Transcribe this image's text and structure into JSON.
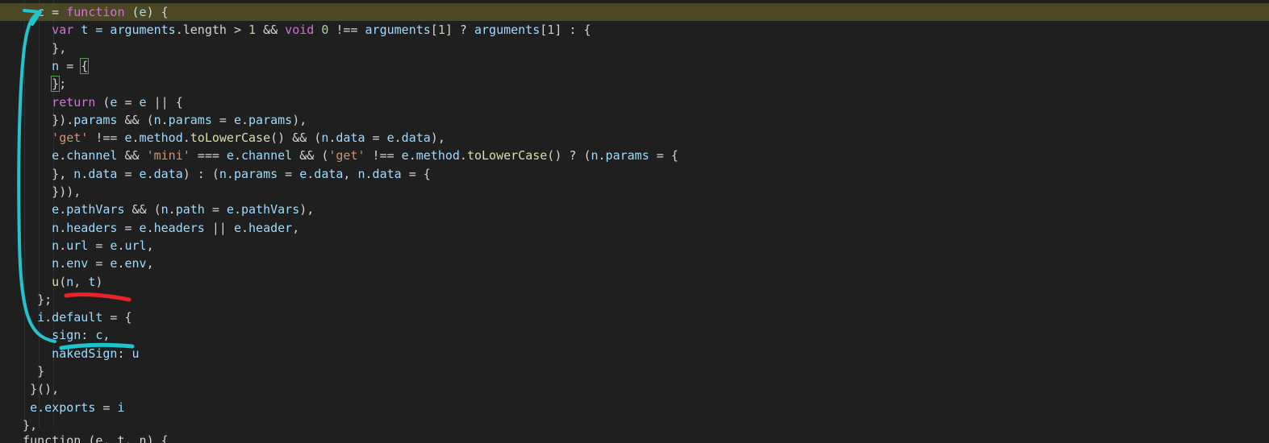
{
  "editor": {
    "lines": [
      {
        "id": "l1",
        "indent": "    ",
        "tokens": [
          {
            "t": "c",
            "k": "var"
          },
          {
            "t": " = ",
            "k": "op"
          },
          {
            "t": "function",
            "k": "kw"
          },
          {
            "t": " (",
            "k": "op"
          },
          {
            "t": "e",
            "k": "var"
          },
          {
            "t": ") {",
            "k": "op"
          }
        ],
        "highlight": true
      },
      {
        "id": "l2",
        "indent": "      ",
        "tokens": [
          {
            "t": "var",
            "k": "kw"
          },
          {
            "t": " t = ",
            "k": "var"
          },
          {
            "t": "arguments",
            "k": "var"
          },
          {
            "t": ".length > ",
            "k": "op"
          },
          {
            "t": "1",
            "k": "num"
          },
          {
            "t": " && ",
            "k": "op"
          },
          {
            "t": "void",
            "k": "kw"
          },
          {
            "t": " 0",
            "k": "num"
          },
          {
            "t": " !== ",
            "k": "op"
          },
          {
            "t": "arguments",
            "k": "var"
          },
          {
            "t": "[",
            "k": "op"
          },
          {
            "t": "1",
            "k": "num"
          },
          {
            "t": "] ? ",
            "k": "op"
          },
          {
            "t": "arguments",
            "k": "var"
          },
          {
            "t": "[",
            "k": "op"
          },
          {
            "t": "1",
            "k": "num"
          },
          {
            "t": "] : {",
            "k": "op"
          }
        ]
      },
      {
        "id": "l3",
        "indent": "      ",
        "tokens": [
          {
            "t": "},",
            "k": "op"
          }
        ]
      },
      {
        "id": "l4",
        "indent": "      ",
        "tokens": [
          {
            "t": "n",
            "k": "var"
          },
          {
            "t": " = ",
            "k": "op"
          },
          {
            "t": "{",
            "k": "box"
          }
        ]
      },
      {
        "id": "l5",
        "indent": "      ",
        "tokens": [
          {
            "t": "}",
            "k": "box"
          },
          {
            "t": ";",
            "k": "op"
          }
        ]
      },
      {
        "id": "l6",
        "indent": "      ",
        "tokens": [
          {
            "t": "return",
            "k": "kw"
          },
          {
            "t": " (",
            "k": "op"
          },
          {
            "t": "e",
            "k": "var"
          },
          {
            "t": " = ",
            "k": "op"
          },
          {
            "t": "e",
            "k": "var"
          },
          {
            "t": " || {",
            "k": "op"
          }
        ]
      },
      {
        "id": "l7",
        "indent": "      ",
        "tokens": [
          {
            "t": "}).",
            "k": "op"
          },
          {
            "t": "params",
            "k": "var"
          },
          {
            "t": " && (",
            "k": "op"
          },
          {
            "t": "n",
            "k": "var"
          },
          {
            "t": ".",
            "k": "op"
          },
          {
            "t": "params",
            "k": "var"
          },
          {
            "t": " = ",
            "k": "op"
          },
          {
            "t": "e",
            "k": "var"
          },
          {
            "t": ".",
            "k": "op"
          },
          {
            "t": "params",
            "k": "var"
          },
          {
            "t": "),",
            "k": "op"
          }
        ]
      },
      {
        "id": "l8",
        "indent": "      ",
        "tokens": [
          {
            "t": "'get'",
            "k": "str"
          },
          {
            "t": " !== ",
            "k": "op"
          },
          {
            "t": "e",
            "k": "var"
          },
          {
            "t": ".",
            "k": "op"
          },
          {
            "t": "method",
            "k": "var"
          },
          {
            "t": ".",
            "k": "op"
          },
          {
            "t": "toLowerCase",
            "k": "fn"
          },
          {
            "t": "() && (",
            "k": "op"
          },
          {
            "t": "n",
            "k": "var"
          },
          {
            "t": ".",
            "k": "op"
          },
          {
            "t": "data",
            "k": "var"
          },
          {
            "t": " = ",
            "k": "op"
          },
          {
            "t": "e",
            "k": "var"
          },
          {
            "t": ".",
            "k": "op"
          },
          {
            "t": "data",
            "k": "var"
          },
          {
            "t": "),",
            "k": "op"
          }
        ]
      },
      {
        "id": "l9",
        "indent": "      ",
        "tokens": [
          {
            "t": "e",
            "k": "var"
          },
          {
            "t": ".",
            "k": "op"
          },
          {
            "t": "channel",
            "k": "var"
          },
          {
            "t": " && ",
            "k": "op"
          },
          {
            "t": "'mini'",
            "k": "str"
          },
          {
            "t": " === ",
            "k": "op"
          },
          {
            "t": "e",
            "k": "var"
          },
          {
            "t": ".",
            "k": "op"
          },
          {
            "t": "channel",
            "k": "var"
          },
          {
            "t": " && (",
            "k": "op"
          },
          {
            "t": "'get'",
            "k": "str"
          },
          {
            "t": " !== ",
            "k": "op"
          },
          {
            "t": "e",
            "k": "var"
          },
          {
            "t": ".",
            "k": "op"
          },
          {
            "t": "method",
            "k": "var"
          },
          {
            "t": ".",
            "k": "op"
          },
          {
            "t": "toLowerCase",
            "k": "fn"
          },
          {
            "t": "() ? (",
            "k": "op"
          },
          {
            "t": "n",
            "k": "var"
          },
          {
            "t": ".",
            "k": "op"
          },
          {
            "t": "params",
            "k": "var"
          },
          {
            "t": " = {",
            "k": "op"
          }
        ]
      },
      {
        "id": "l10",
        "indent": "      ",
        "tokens": [
          {
            "t": "}, ",
            "k": "op"
          },
          {
            "t": "n",
            "k": "var"
          },
          {
            "t": ".",
            "k": "op"
          },
          {
            "t": "data",
            "k": "var"
          },
          {
            "t": " = ",
            "k": "op"
          },
          {
            "t": "e",
            "k": "var"
          },
          {
            "t": ".",
            "k": "op"
          },
          {
            "t": "data",
            "k": "var"
          },
          {
            "t": ") : (",
            "k": "op"
          },
          {
            "t": "n",
            "k": "var"
          },
          {
            "t": ".",
            "k": "op"
          },
          {
            "t": "params",
            "k": "var"
          },
          {
            "t": " = ",
            "k": "op"
          },
          {
            "t": "e",
            "k": "var"
          },
          {
            "t": ".",
            "k": "op"
          },
          {
            "t": "data",
            "k": "var"
          },
          {
            "t": ", ",
            "k": "op"
          },
          {
            "t": "n",
            "k": "var"
          },
          {
            "t": ".",
            "k": "op"
          },
          {
            "t": "data",
            "k": "var"
          },
          {
            "t": " = {",
            "k": "op"
          }
        ]
      },
      {
        "id": "l11",
        "indent": "      ",
        "tokens": [
          {
            "t": "})),",
            "k": "op"
          }
        ]
      },
      {
        "id": "l12",
        "indent": "      ",
        "tokens": [
          {
            "t": "e",
            "k": "var"
          },
          {
            "t": ".",
            "k": "op"
          },
          {
            "t": "pathVars",
            "k": "var"
          },
          {
            "t": " && (",
            "k": "op"
          },
          {
            "t": "n",
            "k": "var"
          },
          {
            "t": ".",
            "k": "op"
          },
          {
            "t": "path",
            "k": "var"
          },
          {
            "t": " = ",
            "k": "op"
          },
          {
            "t": "e",
            "k": "var"
          },
          {
            "t": ".",
            "k": "op"
          },
          {
            "t": "pathVars",
            "k": "var"
          },
          {
            "t": "),",
            "k": "op"
          }
        ]
      },
      {
        "id": "l13",
        "indent": "      ",
        "tokens": [
          {
            "t": "n",
            "k": "var"
          },
          {
            "t": ".",
            "k": "op"
          },
          {
            "t": "headers",
            "k": "var"
          },
          {
            "t": " = ",
            "k": "op"
          },
          {
            "t": "e",
            "k": "var"
          },
          {
            "t": ".",
            "k": "op"
          },
          {
            "t": "headers",
            "k": "var"
          },
          {
            "t": " || ",
            "k": "op"
          },
          {
            "t": "e",
            "k": "var"
          },
          {
            "t": ".",
            "k": "op"
          },
          {
            "t": "header",
            "k": "var"
          },
          {
            "t": ",",
            "k": "op"
          }
        ]
      },
      {
        "id": "l14",
        "indent": "      ",
        "tokens": [
          {
            "t": "n",
            "k": "var"
          },
          {
            "t": ".",
            "k": "op"
          },
          {
            "t": "url",
            "k": "var"
          },
          {
            "t": " = ",
            "k": "op"
          },
          {
            "t": "e",
            "k": "var"
          },
          {
            "t": ".",
            "k": "op"
          },
          {
            "t": "url",
            "k": "var"
          },
          {
            "t": ",",
            "k": "op"
          }
        ]
      },
      {
        "id": "l15",
        "indent": "      ",
        "tokens": [
          {
            "t": "n",
            "k": "var"
          },
          {
            "t": ".",
            "k": "op"
          },
          {
            "t": "env",
            "k": "var"
          },
          {
            "t": " = ",
            "k": "op"
          },
          {
            "t": "e",
            "k": "var"
          },
          {
            "t": ".",
            "k": "op"
          },
          {
            "t": "env",
            "k": "var"
          },
          {
            "t": ",",
            "k": "op"
          }
        ]
      },
      {
        "id": "l16",
        "indent": "      ",
        "tokens": [
          {
            "t": "u",
            "k": "fn"
          },
          {
            "t": "(",
            "k": "op"
          },
          {
            "t": "n",
            "k": "var"
          },
          {
            "t": ", ",
            "k": "op"
          },
          {
            "t": "t",
            "k": "var"
          },
          {
            "t": ")",
            "k": "op"
          }
        ]
      },
      {
        "id": "l17",
        "indent": "    ",
        "tokens": [
          {
            "t": "};",
            "k": "op"
          }
        ]
      },
      {
        "id": "l18",
        "indent": "    ",
        "tokens": [
          {
            "t": "i",
            "k": "var"
          },
          {
            "t": ".",
            "k": "op"
          },
          {
            "t": "default",
            "k": "var"
          },
          {
            "t": " = {",
            "k": "op"
          }
        ]
      },
      {
        "id": "l19",
        "indent": "      ",
        "tokens": [
          {
            "t": "sign",
            "k": "var"
          },
          {
            "t": ": ",
            "k": "op"
          },
          {
            "t": "c",
            "k": "var"
          },
          {
            "t": ",",
            "k": "op"
          }
        ]
      },
      {
        "id": "l20",
        "indent": "      ",
        "tokens": [
          {
            "t": "nakedSign",
            "k": "var"
          },
          {
            "t": ": ",
            "k": "op"
          },
          {
            "t": "u",
            "k": "var"
          }
        ]
      },
      {
        "id": "l21",
        "indent": "    ",
        "tokens": [
          {
            "t": "}",
            "k": "op"
          }
        ]
      },
      {
        "id": "l22",
        "indent": "   ",
        "tokens": [
          {
            "t": "}(),",
            "k": "op"
          }
        ]
      },
      {
        "id": "l23",
        "indent": "   ",
        "tokens": [
          {
            "t": "e",
            "k": "var"
          },
          {
            "t": ".",
            "k": "op"
          },
          {
            "t": "exports",
            "k": "var"
          },
          {
            "t": " = ",
            "k": "op"
          },
          {
            "t": "i",
            "k": "var"
          }
        ]
      },
      {
        "id": "l24",
        "indent": "  ",
        "tokens": [
          {
            "t": "},",
            "k": "op"
          }
        ]
      }
    ],
    "partial_last_line": "  function (e, t, n) {",
    "annotation_colors": {
      "arrow": "#22c3c9",
      "underline_call": "#e8242a",
      "underline_sign": "#18c7cf"
    }
  }
}
